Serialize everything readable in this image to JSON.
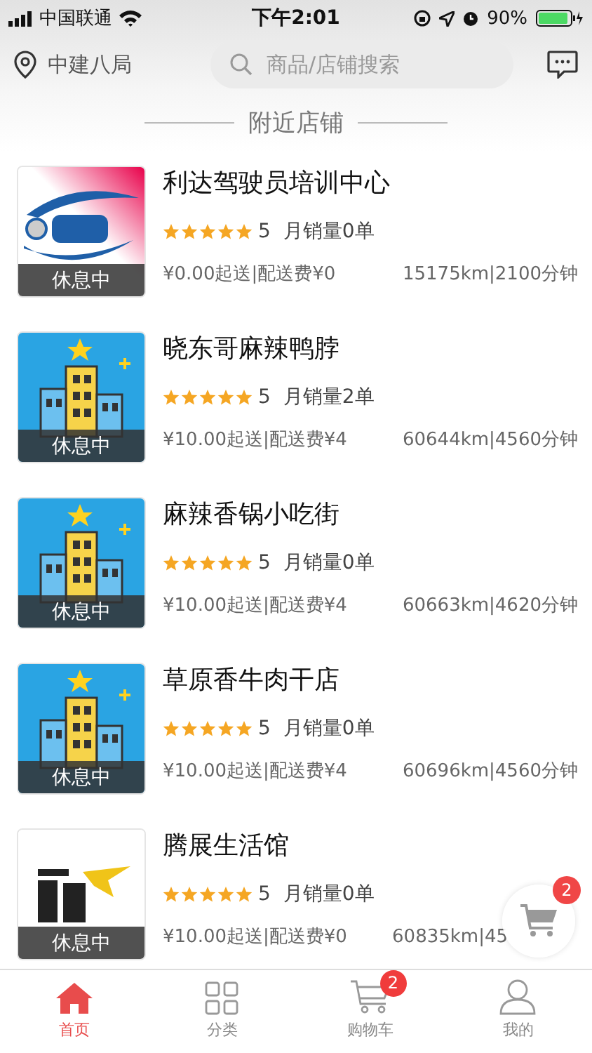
{
  "status_bar": {
    "carrier": "中国联通",
    "time": "下午2:01",
    "battery": "90%"
  },
  "header": {
    "location": "中建八局",
    "search": {
      "placeholder": "商品/店铺搜索"
    }
  },
  "section_title": "附近店铺",
  "stores": [
    {
      "kind": "picture",
      "status": "休息中",
      "name": "利达驾驶员培训中心",
      "stars": 5,
      "rating": "5",
      "sales": "月销量0单",
      "fee": "¥0.00起送|配送费¥0",
      "distance": "15175km|2100分钟"
    },
    {
      "kind": "building",
      "status": "休息中",
      "name": "晓东哥麻辣鸭脖",
      "stars": 5,
      "rating": "5",
      "sales": "月销量2单",
      "fee": "¥10.00起送|配送费¥4",
      "distance": "60644km|4560分钟"
    },
    {
      "kind": "building",
      "status": "休息中",
      "name": "麻辣香锅小吃街",
      "stars": 5,
      "rating": "5",
      "sales": "月销量0单",
      "fee": "¥10.00起送|配送费¥4",
      "distance": "60663km|4620分钟"
    },
    {
      "kind": "building",
      "status": "休息中",
      "name": "草原香牛肉干店",
      "stars": 5,
      "rating": "5",
      "sales": "月销量0单",
      "fee": "¥10.00起送|配送费¥4",
      "distance": "60696km|4560分钟"
    },
    {
      "kind": "picture",
      "status": "休息中",
      "name": "腾展生活馆",
      "stars": 5,
      "rating": "5",
      "sales": "月销量0单",
      "fee": "¥10.00起送|配送费¥0",
      "distance": "60835km|45"
    }
  ],
  "floating_cart": {
    "badge": "2"
  },
  "tab_bar": [
    {
      "label": "首页",
      "selected": true
    },
    {
      "label": "分类",
      "selected": false
    },
    {
      "label": "购物车",
      "selected": false,
      "badge": "2"
    },
    {
      "label": "我的",
      "selected": false
    }
  ]
}
